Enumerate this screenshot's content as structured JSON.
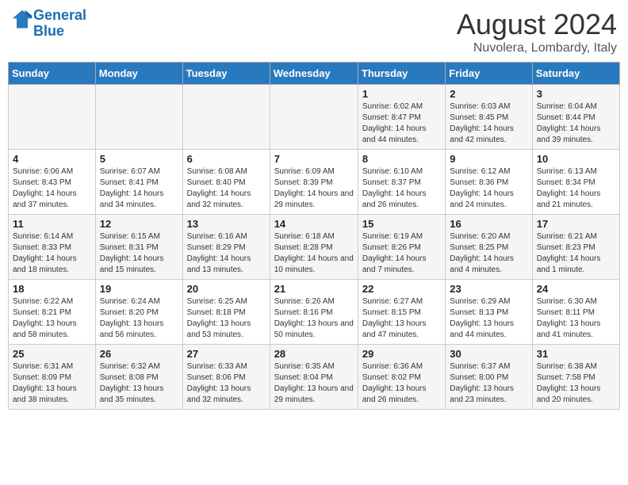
{
  "header": {
    "logo_line1": "General",
    "logo_line2": "Blue",
    "month_year": "August 2024",
    "location": "Nuvolera, Lombardy, Italy"
  },
  "days_of_week": [
    "Sunday",
    "Monday",
    "Tuesday",
    "Wednesday",
    "Thursday",
    "Friday",
    "Saturday"
  ],
  "weeks": [
    [
      {
        "day": "",
        "info": ""
      },
      {
        "day": "",
        "info": ""
      },
      {
        "day": "",
        "info": ""
      },
      {
        "day": "",
        "info": ""
      },
      {
        "day": "1",
        "info": "Sunrise: 6:02 AM\nSunset: 8:47 PM\nDaylight: 14 hours and 44 minutes."
      },
      {
        "day": "2",
        "info": "Sunrise: 6:03 AM\nSunset: 8:45 PM\nDaylight: 14 hours and 42 minutes."
      },
      {
        "day": "3",
        "info": "Sunrise: 6:04 AM\nSunset: 8:44 PM\nDaylight: 14 hours and 39 minutes."
      }
    ],
    [
      {
        "day": "4",
        "info": "Sunrise: 6:06 AM\nSunset: 8:43 PM\nDaylight: 14 hours and 37 minutes."
      },
      {
        "day": "5",
        "info": "Sunrise: 6:07 AM\nSunset: 8:41 PM\nDaylight: 14 hours and 34 minutes."
      },
      {
        "day": "6",
        "info": "Sunrise: 6:08 AM\nSunset: 8:40 PM\nDaylight: 14 hours and 32 minutes."
      },
      {
        "day": "7",
        "info": "Sunrise: 6:09 AM\nSunset: 8:39 PM\nDaylight: 14 hours and 29 minutes."
      },
      {
        "day": "8",
        "info": "Sunrise: 6:10 AM\nSunset: 8:37 PM\nDaylight: 14 hours and 26 minutes."
      },
      {
        "day": "9",
        "info": "Sunrise: 6:12 AM\nSunset: 8:36 PM\nDaylight: 14 hours and 24 minutes."
      },
      {
        "day": "10",
        "info": "Sunrise: 6:13 AM\nSunset: 8:34 PM\nDaylight: 14 hours and 21 minutes."
      }
    ],
    [
      {
        "day": "11",
        "info": "Sunrise: 6:14 AM\nSunset: 8:33 PM\nDaylight: 14 hours and 18 minutes."
      },
      {
        "day": "12",
        "info": "Sunrise: 6:15 AM\nSunset: 8:31 PM\nDaylight: 14 hours and 15 minutes."
      },
      {
        "day": "13",
        "info": "Sunrise: 6:16 AM\nSunset: 8:29 PM\nDaylight: 14 hours and 13 minutes."
      },
      {
        "day": "14",
        "info": "Sunrise: 6:18 AM\nSunset: 8:28 PM\nDaylight: 14 hours and 10 minutes."
      },
      {
        "day": "15",
        "info": "Sunrise: 6:19 AM\nSunset: 8:26 PM\nDaylight: 14 hours and 7 minutes."
      },
      {
        "day": "16",
        "info": "Sunrise: 6:20 AM\nSunset: 8:25 PM\nDaylight: 14 hours and 4 minutes."
      },
      {
        "day": "17",
        "info": "Sunrise: 6:21 AM\nSunset: 8:23 PM\nDaylight: 14 hours and 1 minute."
      }
    ],
    [
      {
        "day": "18",
        "info": "Sunrise: 6:22 AM\nSunset: 8:21 PM\nDaylight: 13 hours and 58 minutes."
      },
      {
        "day": "19",
        "info": "Sunrise: 6:24 AM\nSunset: 8:20 PM\nDaylight: 13 hours and 56 minutes."
      },
      {
        "day": "20",
        "info": "Sunrise: 6:25 AM\nSunset: 8:18 PM\nDaylight: 13 hours and 53 minutes."
      },
      {
        "day": "21",
        "info": "Sunrise: 6:26 AM\nSunset: 8:16 PM\nDaylight: 13 hours and 50 minutes."
      },
      {
        "day": "22",
        "info": "Sunrise: 6:27 AM\nSunset: 8:15 PM\nDaylight: 13 hours and 47 minutes."
      },
      {
        "day": "23",
        "info": "Sunrise: 6:29 AM\nSunset: 8:13 PM\nDaylight: 13 hours and 44 minutes."
      },
      {
        "day": "24",
        "info": "Sunrise: 6:30 AM\nSunset: 8:11 PM\nDaylight: 13 hours and 41 minutes."
      }
    ],
    [
      {
        "day": "25",
        "info": "Sunrise: 6:31 AM\nSunset: 8:09 PM\nDaylight: 13 hours and 38 minutes."
      },
      {
        "day": "26",
        "info": "Sunrise: 6:32 AM\nSunset: 8:08 PM\nDaylight: 13 hours and 35 minutes."
      },
      {
        "day": "27",
        "info": "Sunrise: 6:33 AM\nSunset: 8:06 PM\nDaylight: 13 hours and 32 minutes."
      },
      {
        "day": "28",
        "info": "Sunrise: 6:35 AM\nSunset: 8:04 PM\nDaylight: 13 hours and 29 minutes."
      },
      {
        "day": "29",
        "info": "Sunrise: 6:36 AM\nSunset: 8:02 PM\nDaylight: 13 hours and 26 minutes."
      },
      {
        "day": "30",
        "info": "Sunrise: 6:37 AM\nSunset: 8:00 PM\nDaylight: 13 hours and 23 minutes."
      },
      {
        "day": "31",
        "info": "Sunrise: 6:38 AM\nSunset: 7:58 PM\nDaylight: 13 hours and 20 minutes."
      }
    ]
  ]
}
